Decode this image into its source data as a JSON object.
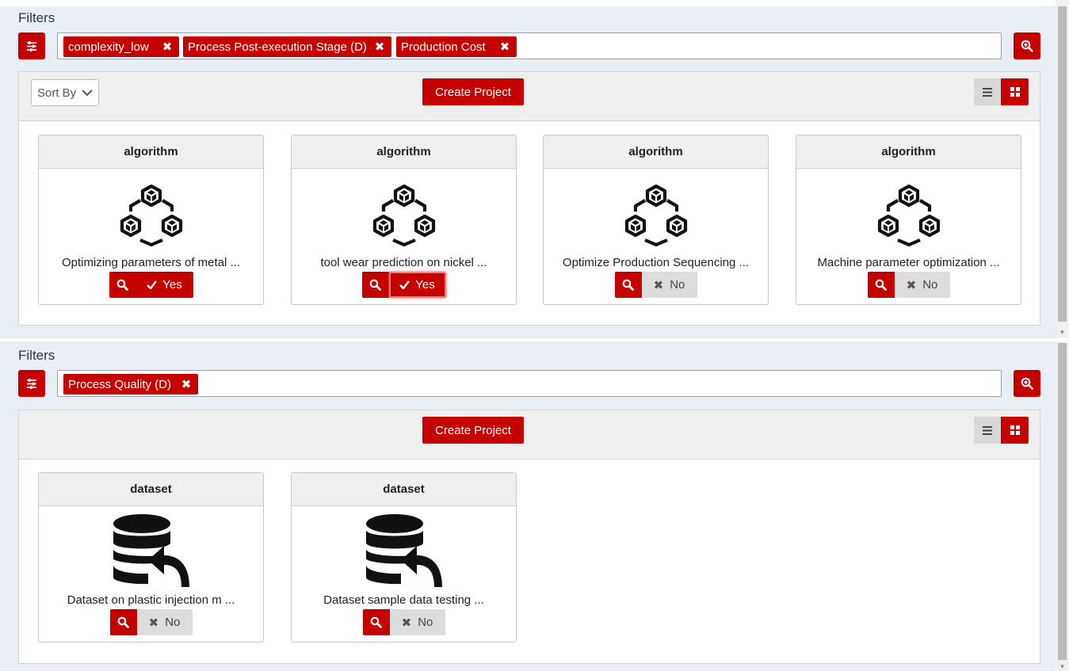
{
  "panel1": {
    "filters_label": "Filters",
    "chips": [
      {
        "label": "complexity_low",
        "remove_icon": "close-icon"
      },
      {
        "label": "Process Post-execution Stage (D)",
        "remove_icon": "close-icon"
      },
      {
        "label": "Production Cost",
        "remove_icon": "close-icon"
      }
    ],
    "sort_by": "Sort By",
    "create_project": "Create Project",
    "cards": [
      {
        "type": "algorithm",
        "description": "Optimizing parameters of metal ...",
        "status": "Yes"
      },
      {
        "type": "algorithm",
        "description": "tool wear prediction on nickel ...",
        "status": "Yes"
      },
      {
        "type": "algorithm",
        "description": "Optimize Production Sequencing ...",
        "status": "No"
      },
      {
        "type": "algorithm",
        "description": "Machine parameter optimization ...",
        "status": "No"
      }
    ]
  },
  "panel2": {
    "filters_label": "Filters",
    "chips": [
      {
        "label": "Process Quality (D)",
        "remove_icon": "close-icon"
      }
    ],
    "create_project": "Create Project",
    "cards": [
      {
        "type": "dataset",
        "description": "Dataset on plastic injection m ...",
        "status": "No"
      },
      {
        "type": "dataset",
        "description": "Dataset sample data testing ...",
        "status": "No"
      }
    ]
  },
  "colors": {
    "accent": "#c40000",
    "panel_bg": "#e9edf4",
    "toolbar_bg": "#efefef",
    "neutral_button": "#dcdcdc"
  },
  "icons": {
    "filter_toggle": "sliders-icon",
    "search_filters": "search-plus-icon",
    "view_list": "list-icon",
    "view_grid": "grid-icon",
    "algorithm": "cubes-network-icon",
    "dataset": "database-import-icon",
    "view": "search-icon",
    "yes": "check-icon",
    "no": "close-icon"
  }
}
